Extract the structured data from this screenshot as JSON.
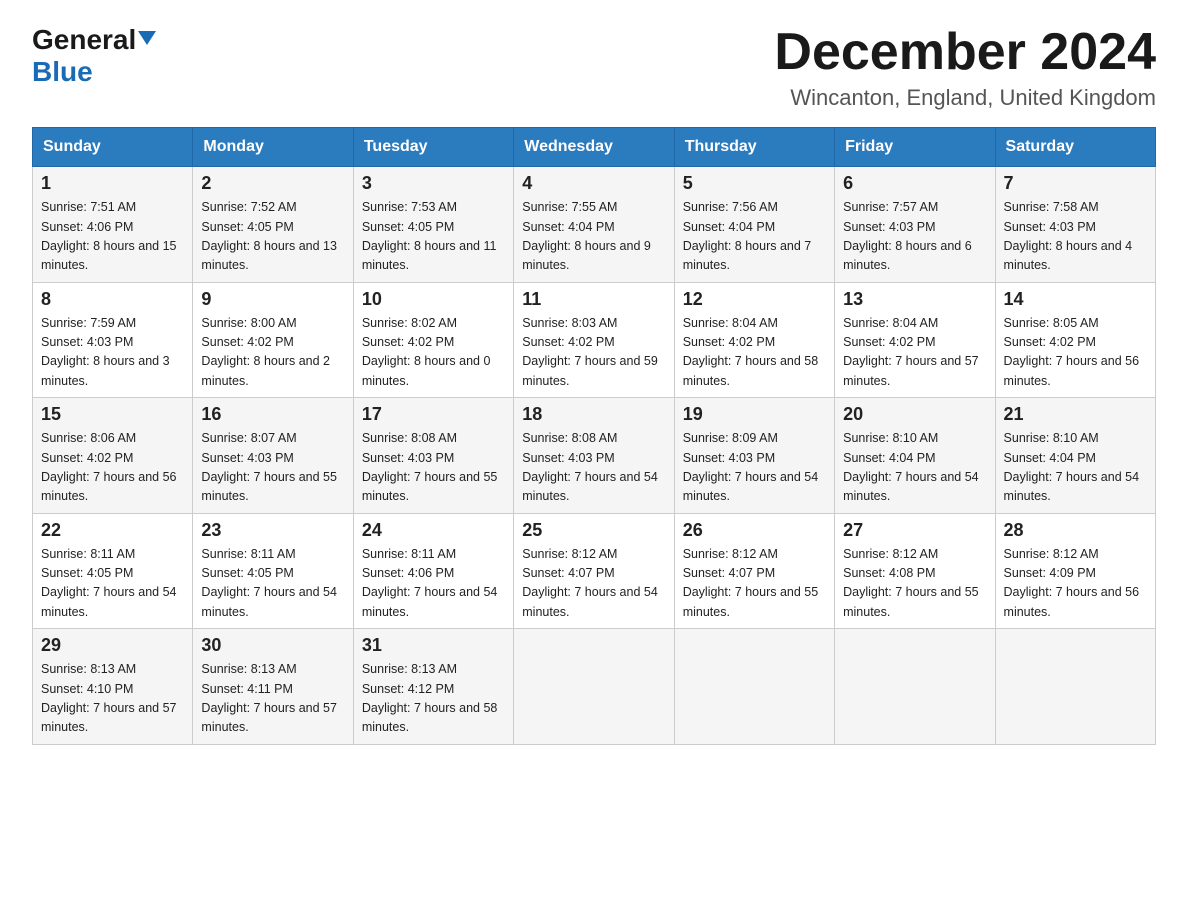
{
  "header": {
    "logo_general": "General",
    "logo_blue": "Blue",
    "month_title": "December 2024",
    "location": "Wincanton, England, United Kingdom"
  },
  "days_of_week": [
    "Sunday",
    "Monday",
    "Tuesday",
    "Wednesday",
    "Thursday",
    "Friday",
    "Saturday"
  ],
  "weeks": [
    [
      {
        "day": "1",
        "sunrise": "7:51 AM",
        "sunset": "4:06 PM",
        "daylight": "8 hours and 15 minutes."
      },
      {
        "day": "2",
        "sunrise": "7:52 AM",
        "sunset": "4:05 PM",
        "daylight": "8 hours and 13 minutes."
      },
      {
        "day": "3",
        "sunrise": "7:53 AM",
        "sunset": "4:05 PM",
        "daylight": "8 hours and 11 minutes."
      },
      {
        "day": "4",
        "sunrise": "7:55 AM",
        "sunset": "4:04 PM",
        "daylight": "8 hours and 9 minutes."
      },
      {
        "day": "5",
        "sunrise": "7:56 AM",
        "sunset": "4:04 PM",
        "daylight": "8 hours and 7 minutes."
      },
      {
        "day": "6",
        "sunrise": "7:57 AM",
        "sunset": "4:03 PM",
        "daylight": "8 hours and 6 minutes."
      },
      {
        "day": "7",
        "sunrise": "7:58 AM",
        "sunset": "4:03 PM",
        "daylight": "8 hours and 4 minutes."
      }
    ],
    [
      {
        "day": "8",
        "sunrise": "7:59 AM",
        "sunset": "4:03 PM",
        "daylight": "8 hours and 3 minutes."
      },
      {
        "day": "9",
        "sunrise": "8:00 AM",
        "sunset": "4:02 PM",
        "daylight": "8 hours and 2 minutes."
      },
      {
        "day": "10",
        "sunrise": "8:02 AM",
        "sunset": "4:02 PM",
        "daylight": "8 hours and 0 minutes."
      },
      {
        "day": "11",
        "sunrise": "8:03 AM",
        "sunset": "4:02 PM",
        "daylight": "7 hours and 59 minutes."
      },
      {
        "day": "12",
        "sunrise": "8:04 AM",
        "sunset": "4:02 PM",
        "daylight": "7 hours and 58 minutes."
      },
      {
        "day": "13",
        "sunrise": "8:04 AM",
        "sunset": "4:02 PM",
        "daylight": "7 hours and 57 minutes."
      },
      {
        "day": "14",
        "sunrise": "8:05 AM",
        "sunset": "4:02 PM",
        "daylight": "7 hours and 56 minutes."
      }
    ],
    [
      {
        "day": "15",
        "sunrise": "8:06 AM",
        "sunset": "4:02 PM",
        "daylight": "7 hours and 56 minutes."
      },
      {
        "day": "16",
        "sunrise": "8:07 AM",
        "sunset": "4:03 PM",
        "daylight": "7 hours and 55 minutes."
      },
      {
        "day": "17",
        "sunrise": "8:08 AM",
        "sunset": "4:03 PM",
        "daylight": "7 hours and 55 minutes."
      },
      {
        "day": "18",
        "sunrise": "8:08 AM",
        "sunset": "4:03 PM",
        "daylight": "7 hours and 54 minutes."
      },
      {
        "day": "19",
        "sunrise": "8:09 AM",
        "sunset": "4:03 PM",
        "daylight": "7 hours and 54 minutes."
      },
      {
        "day": "20",
        "sunrise": "8:10 AM",
        "sunset": "4:04 PM",
        "daylight": "7 hours and 54 minutes."
      },
      {
        "day": "21",
        "sunrise": "8:10 AM",
        "sunset": "4:04 PM",
        "daylight": "7 hours and 54 minutes."
      }
    ],
    [
      {
        "day": "22",
        "sunrise": "8:11 AM",
        "sunset": "4:05 PM",
        "daylight": "7 hours and 54 minutes."
      },
      {
        "day": "23",
        "sunrise": "8:11 AM",
        "sunset": "4:05 PM",
        "daylight": "7 hours and 54 minutes."
      },
      {
        "day": "24",
        "sunrise": "8:11 AM",
        "sunset": "4:06 PM",
        "daylight": "7 hours and 54 minutes."
      },
      {
        "day": "25",
        "sunrise": "8:12 AM",
        "sunset": "4:07 PM",
        "daylight": "7 hours and 54 minutes."
      },
      {
        "day": "26",
        "sunrise": "8:12 AM",
        "sunset": "4:07 PM",
        "daylight": "7 hours and 55 minutes."
      },
      {
        "day": "27",
        "sunrise": "8:12 AM",
        "sunset": "4:08 PM",
        "daylight": "7 hours and 55 minutes."
      },
      {
        "day": "28",
        "sunrise": "8:12 AM",
        "sunset": "4:09 PM",
        "daylight": "7 hours and 56 minutes."
      }
    ],
    [
      {
        "day": "29",
        "sunrise": "8:13 AM",
        "sunset": "4:10 PM",
        "daylight": "7 hours and 57 minutes."
      },
      {
        "day": "30",
        "sunrise": "8:13 AM",
        "sunset": "4:11 PM",
        "daylight": "7 hours and 57 minutes."
      },
      {
        "day": "31",
        "sunrise": "8:13 AM",
        "sunset": "4:12 PM",
        "daylight": "7 hours and 58 minutes."
      },
      null,
      null,
      null,
      null
    ]
  ]
}
